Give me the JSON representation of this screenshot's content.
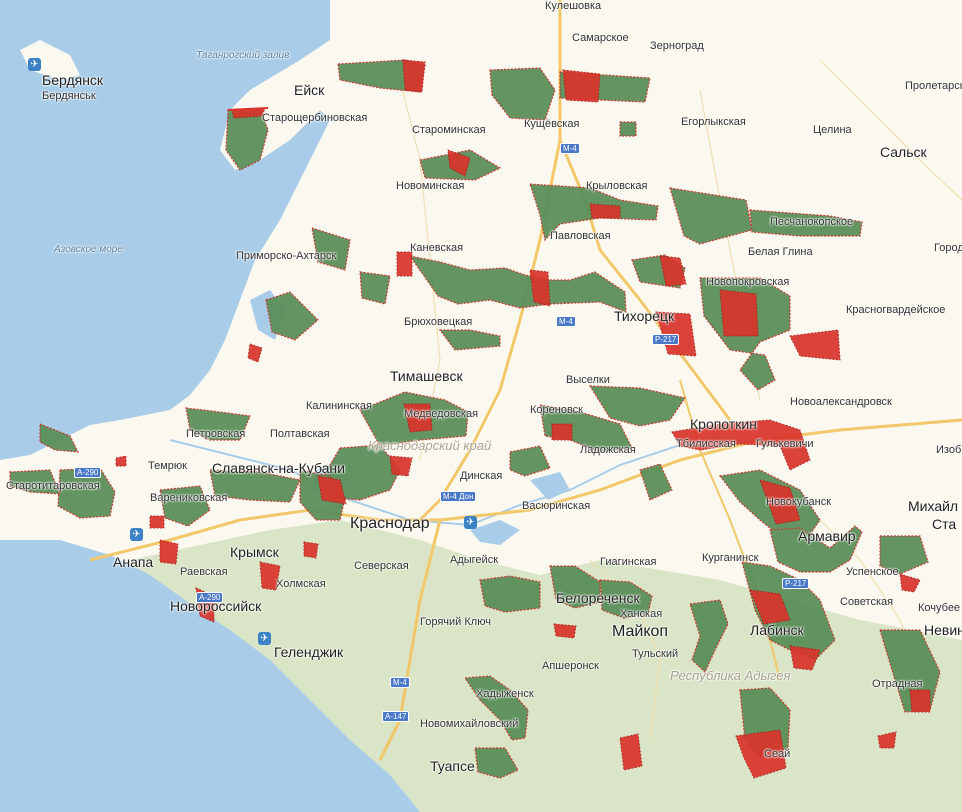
{
  "map": {
    "colors": {
      "land": "#fbf8ef",
      "sea": "#a9cde8",
      "forest": "#d9e5c6",
      "road_major": "#f2c86a",
      "road_minor": "#ffffff",
      "zone_green": "#5b8f5a",
      "zone_red": "#d9342b"
    },
    "labels": {
      "kuleshovka": "Кулешовка",
      "samarskoe": "Самарское",
      "zernograd": "Зерноград",
      "taganrog_bay": "Таганрогский залив",
      "berdyansk": "Бердянск",
      "berdyansk_sub": "Бердянськ",
      "proletarsk": "Пролетарск",
      "eysk": "Ейск",
      "starosherbinovskaya": "Старощербиновская",
      "starominskaya": "Староминская",
      "kushevskaya": "Кущёвская",
      "egorlykskaya": "Егорлыкская",
      "tselina": "Целина",
      "salsk": "Сальск",
      "novominskaya": "Новоминская",
      "krylovskaya": "Крыловская",
      "peschanokopskoe": "Песчанокопское",
      "azov_sea": "Азовское море",
      "kanevskaya": "Каневская",
      "pavlovskaya": "Павловская",
      "belaya_glina": "Белая Глина",
      "gorod": "Город",
      "primorsko_akhtarsk": "Приморско-Ахтарск",
      "novopokrovskaya": "Новопокровская",
      "krasnogvardeyskoe": "Красногвардейское",
      "bryukhovetskaya": "Брюховецкая",
      "tikhoretsk": "Тихорецк",
      "timashevsk": "Тимашевск",
      "vyselki": "Выселки",
      "kalininskaya": "Калининская",
      "medvedovskaya": "Медведовская",
      "korenovsk": "Кореновск",
      "novoaleksandrovsk": "Новоалександровск",
      "petrovskaya": "Петровская",
      "poltavskaya": "Полтавская",
      "krasnodar_krai": "Краснодарский край",
      "kropotkin": "Кропоткин",
      "tbilisskaya": "Тбилисская",
      "ladozhskaya": "Ладожская",
      "gulkevichi": "Гулькевичи",
      "izob": "Изоб",
      "temryuk": "Темрюк",
      "slavyansk": "Славянск-на-Кубани",
      "dinskaya": "Динская",
      "starotitarovskaya": "Старотитаровская",
      "novokubansk": "Новокубанск",
      "varenikovskaya": "Варениковская",
      "krasnodar": "Краснодар",
      "vasyurinskaya": "Васюринская",
      "mikhaylovsk": "Михайл",
      "sta": "Ста",
      "armavir": "Армавир",
      "anapa": "Анапа",
      "krymsk": "Крымск",
      "adygeysk": "Адыгейск",
      "giaginskaya": "Гиагинская",
      "kurganinsk": "Курганинск",
      "uspenskoe": "Успенское",
      "raevskaya": "Раевская",
      "kholmskaya": "Холмская",
      "severskaya": "Северская",
      "belorechensk": "Белореченск",
      "khanskaya": "Ханская",
      "sovetskaya": "Советская",
      "kochubeev": "Кочубее",
      "novorossiysk": "Новороссийск",
      "goryachiy_klyuch": "Горячий Ключ",
      "maykop": "Майкоп",
      "tulskiy": "Тульский",
      "labinsk": "Лабинск",
      "nevin": "Невин",
      "gelendzhik": "Геленджик",
      "apsheronsk": "Апшеронск",
      "adygea": "Республика Адыгея",
      "otradnaya": "Отрадная",
      "khadyzhensk": "Хадыженск",
      "novomikhaylovskiy": "Новомихайловский",
      "tuapse": "Туапсе",
      "seversk_s": "Сеай"
    },
    "shields": {
      "m4_a": "M-4",
      "r217_a": "P-217",
      "m4_b": "M-4",
      "m4_c": "M-4 Дон",
      "a290_a": "A-290",
      "a290_b": "A-290",
      "r217_b": "P-217",
      "m4_d": "M-4",
      "a147": "A-147"
    },
    "icons": {
      "airport": "airplane-icon"
    }
  }
}
